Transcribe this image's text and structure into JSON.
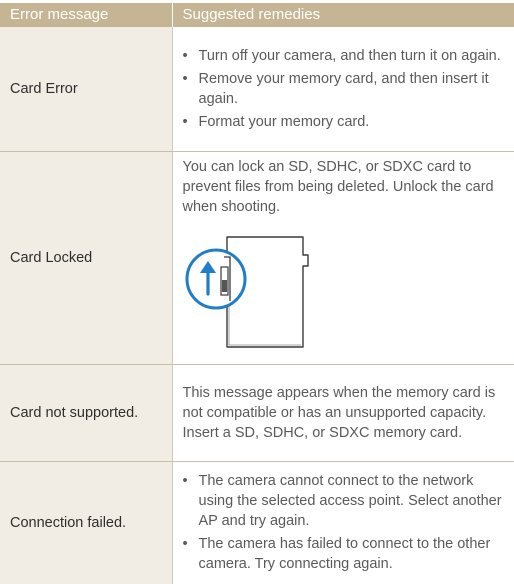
{
  "table": {
    "headers": {
      "error_message": "Error message",
      "suggested_remedies": "Suggested remedies"
    },
    "rows": [
      {
        "error": "Card Error",
        "remedies": [
          "Turn off your camera, and then turn it on again.",
          "Remove your memory card, and then insert it again.",
          "Format your memory card."
        ]
      },
      {
        "error": "Card Locked",
        "text": "You can lock an SD, SDHC, or SDXC card to prevent files from being deleted. Unlock the card when shooting."
      },
      {
        "error": "Card not supported.",
        "text": "This message appears when the memory card is not compatible or has an unsupported capacity. Insert a SD, SDHC, or SDXC memory card."
      },
      {
        "error": "Connection failed.",
        "remedies": [
          "The camera cannot connect to the network using the selected access point. Select another AP and try again.",
          "The camera has failed to connect to the other camera. Try connecting again."
        ]
      }
    ]
  },
  "icons": {
    "sd_card_lock": "sd-card-lock-switch-illustration"
  },
  "colors": {
    "header_bg": "#c5b594",
    "message_col_bg": "#f1ede5",
    "accent_blue": "#1f7ec6",
    "rule": "#c9bfae"
  }
}
